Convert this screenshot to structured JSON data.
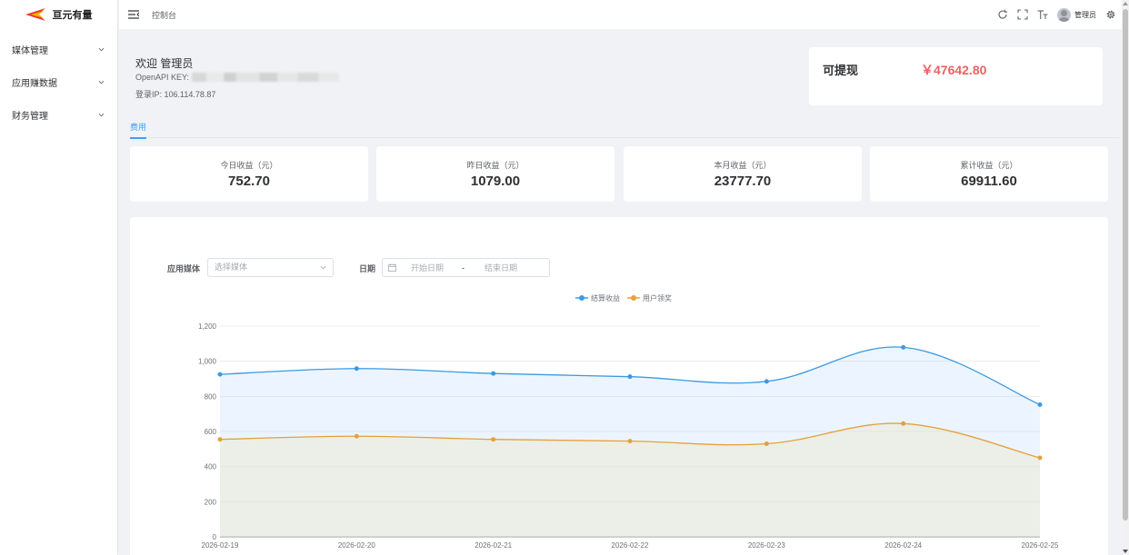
{
  "brand": {
    "name": "亘元有量"
  },
  "sidebar": {
    "items": [
      {
        "label": "媒体管理"
      },
      {
        "label": "应用赚数据"
      },
      {
        "label": "财务管理"
      }
    ]
  },
  "topbar": {
    "breadcrumb": "控制台",
    "username": "管理员"
  },
  "welcome": {
    "title": "欢迎 管理员",
    "api_key_label": "OpenAPI KEY:",
    "login_ip": "登录IP: 106.114.78.87"
  },
  "withdraw": {
    "label": "可提现",
    "value": "￥47642.80"
  },
  "tabs": [
    {
      "label": "费用"
    }
  ],
  "stats": [
    {
      "label": "今日收益（元）",
      "value": "752.70"
    },
    {
      "label": "昨日收益（元）",
      "value": "1079.00"
    },
    {
      "label": "本月收益（元）",
      "value": "23777.70"
    },
    {
      "label": "累计收益（元）",
      "value": "69911.60"
    }
  ],
  "filters": {
    "media_label": "应用媒体",
    "media_placeholder": "选择媒体",
    "date_label": "日期",
    "start_placeholder": "开始日期",
    "separator": "-",
    "end_placeholder": "结束日期"
  },
  "colors": {
    "accent": "#409eff",
    "withdraw_value": "#ef6161",
    "series_settled": "#3b9ae1",
    "series_user": "#e5a13b"
  },
  "chart_data": {
    "type": "area",
    "x": [
      "2026-02-19",
      "2026-02-20",
      "2026-02-21",
      "2026-02-22",
      "2026-02-23",
      "2026-02-24",
      "2026-02-25"
    ],
    "series": [
      {
        "name": "结算收益",
        "values": [
          925,
          958,
          930,
          912,
          885,
          1079,
          752.7
        ]
      },
      {
        "name": "用户领奖",
        "values": [
          555,
          573,
          555,
          545,
          530,
          645,
          450
        ]
      }
    ],
    "ylim": [
      0,
      1200
    ],
    "yticks": [
      0,
      200,
      400,
      600,
      800,
      1000,
      1200
    ],
    "ytick_labels": [
      "0",
      "200",
      "400",
      "600",
      "800",
      "1,000",
      "1,200"
    ],
    "grid": true,
    "legend_position": "top-center"
  }
}
